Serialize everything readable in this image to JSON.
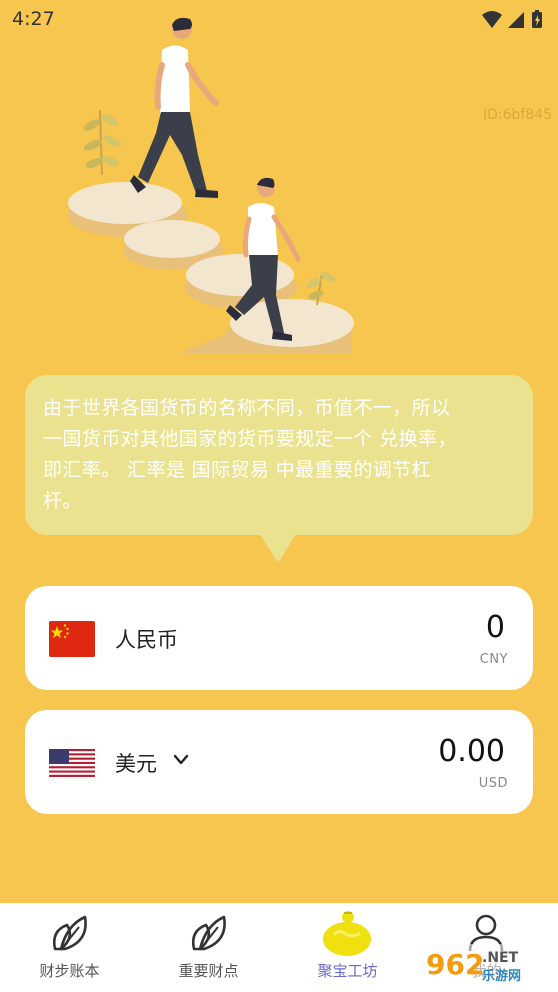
{
  "status_bar": {
    "time": "4:27"
  },
  "hero": {
    "id_text": "ID:6bf845"
  },
  "bubble": {
    "lines": [
      "由于世界各国货币的名称不同，币值不一，所以",
      "一国货币对其他国家的货币要规定一个 兑换率，",
      "即汇率。 汇率是 国际贸易 中最重要的调节杠",
      "杆。"
    ]
  },
  "currencies": [
    {
      "name": "人民币",
      "amount": "0",
      "code": "CNY",
      "flag": "china-flag-icon"
    },
    {
      "name": "美元",
      "amount": "0.00",
      "code": "USD",
      "flag": "usa-flag-icon"
    }
  ],
  "bottom_nav": [
    {
      "label": "财步账本",
      "icon": "leaf-icon"
    },
    {
      "label": "重要财点",
      "icon": "leaf-icon"
    },
    {
      "label": "聚宝工坊",
      "icon": "coin-pot-icon",
      "active": true
    },
    {
      "label": "我的",
      "icon": "person-icon"
    }
  ],
  "watermark": {
    "text_a": "962",
    "text_b": ".NET",
    "text_c": "乐游网"
  },
  "colors": {
    "background": "#F7C64E",
    "bubble": "#EBE28F",
    "active_tab": "#6A67C8"
  }
}
